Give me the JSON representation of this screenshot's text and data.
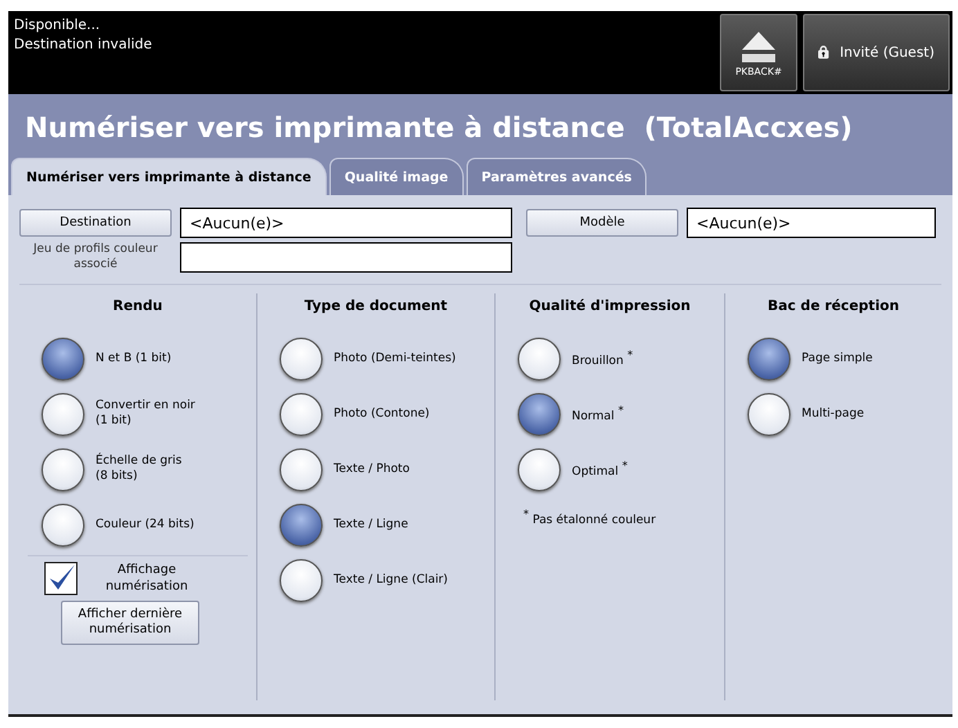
{
  "status": {
    "lines": [
      "Disponible...",
      "Destination invalide"
    ]
  },
  "eject_button": {
    "label": "PKBACK#"
  },
  "user_button": {
    "label": "Invité (Guest)"
  },
  "title": "Numériser vers imprimante à distance  (TotalAccxes)",
  "tabs": [
    {
      "label": "Numériser vers imprimante à distance",
      "selected": true
    },
    {
      "label": "Qualité image",
      "selected": false
    },
    {
      "label": "Paramètres avancés",
      "selected": false
    }
  ],
  "destination": {
    "button": "Destination",
    "value": "<Aucun(e)>"
  },
  "template": {
    "button": "Modèle",
    "value": "<Aucun(e)>"
  },
  "color_profile": {
    "label": "Jeu de profils couleur associé"
  },
  "groups": [
    {
      "title": "Rendu",
      "options": [
        {
          "label": "N et B  (1 bit)",
          "selected": true
        },
        {
          "label": "Convertir en noir\n (1 bit)",
          "selected": false
        },
        {
          "label": "Échelle de gris\n(8 bits)",
          "selected": false
        },
        {
          "label": "Couleur (24 bits)",
          "selected": false
        }
      ]
    },
    {
      "title": "Type de document",
      "options": [
        {
          "label": "Photo (Demi-teintes)",
          "selected": false
        },
        {
          "label": "Photo (Contone)",
          "selected": false
        },
        {
          "label": "Texte / Photo",
          "selected": false
        },
        {
          "label": "Texte / Ligne",
          "selected": true
        },
        {
          "label": "Texte / Ligne (Clair)",
          "selected": false
        }
      ]
    },
    {
      "title": "Qualité d'impression",
      "options": [
        {
          "label": "Brouillon $^{*}$",
          "selected": false
        },
        {
          "label": "Normal $^{*}$",
          "selected": true
        },
        {
          "label": "Optimal $^{*}$",
          "selected": false
        }
      ],
      "note": "$^{*}$ Pas étalonné couleur"
    },
    {
      "title": "Bac de réception",
      "options": [
        {
          "label": "Page simple",
          "selected": true
        },
        {
          "label": "Multi-page",
          "selected": false
        }
      ]
    }
  ],
  "scan_display": {
    "label": "Affichage numérisation",
    "checked": true
  },
  "show_last_button": "Afficher dernière numérisation"
}
